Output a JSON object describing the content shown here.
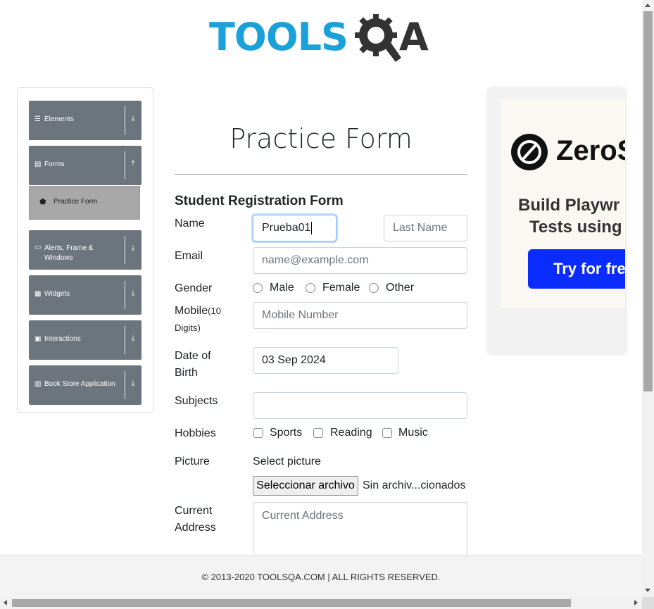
{
  "header": {
    "logo_left": "TOOLS",
    "logo_right": "A",
    "logo_colors": {
      "tools": "#1aa1d9",
      "qa": "#333333"
    }
  },
  "sidebar": {
    "groups": [
      {
        "label": "Elements",
        "icon": "menu-icon"
      },
      {
        "label": "Forms",
        "icon": "forms-icon"
      },
      {
        "label": "Alerts, Frame &",
        "label2": "Windows",
        "icon": "window-icon"
      },
      {
        "label": "Widgets",
        "icon": "widgets-icon"
      },
      {
        "label": "Interactions",
        "icon": "interactions-icon"
      },
      {
        "label": "Book Store Application",
        "icon": "book-icon"
      }
    ],
    "active_item": {
      "label": "Practice Form",
      "icon": "html5-icon"
    },
    "colors": {
      "group_bg": "#6c757d",
      "active_bg": "#a8a8a8"
    }
  },
  "form": {
    "page_title": "Practice Form",
    "section_title": "Student Registration Form",
    "name_label": "Name",
    "first_name_value": "Prueba01",
    "last_name_placeholder": "Last Name",
    "email_label": "Email",
    "email_placeholder": "name@example.com",
    "gender_label": "Gender",
    "gender_options": [
      "Male",
      "Female",
      "Other"
    ],
    "mobile_label": "Mobile",
    "mobile_hint": "(10",
    "mobile_hint2": "Digits)",
    "mobile_placeholder": "Mobile Number",
    "dob_label1": "Date of",
    "dob_label2": "Birth",
    "dob_value": "03 Sep 2024",
    "subjects_label": "Subjects",
    "hobbies_label": "Hobbies",
    "hobby_options": [
      "Sports",
      "Reading",
      "Music"
    ],
    "picture_label": "Picture",
    "picture_hint": "Select picture",
    "file_button": "Seleccionar archivo",
    "file_status": "Sin archiv...cionados",
    "address_label1": "Current",
    "address_label2": "Address",
    "address_placeholder": "Current Address"
  },
  "ad": {
    "brand": "ZeroS",
    "tagline1": "Build Playwr",
    "tagline2": "Tests using",
    "cta": "Try for free",
    "cta_color": "#0a2cff"
  },
  "footer": {
    "text": "© 2013-2020 TOOLSQA.COM | ALL RIGHTS RESERVED."
  }
}
